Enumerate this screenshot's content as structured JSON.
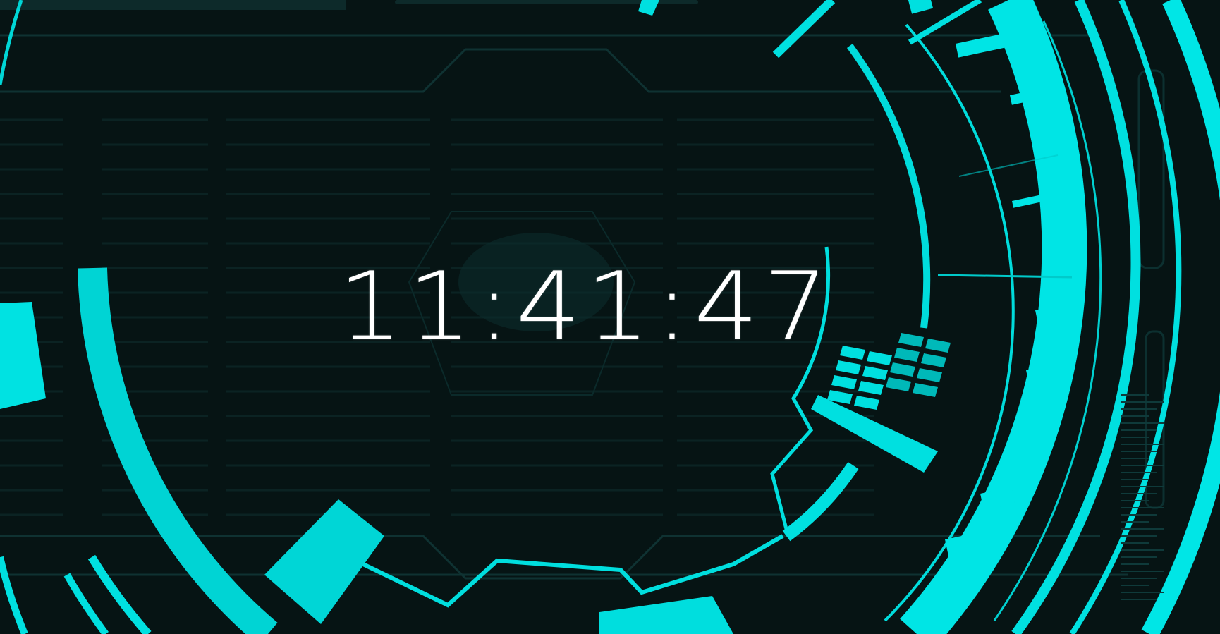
{
  "clock": {
    "time": "11:41:47"
  },
  "colors": {
    "background": "#061414",
    "panel": "#0a2424",
    "grid": "#123434",
    "accent": "#00e5e5",
    "accent_dim": "#00b8b8",
    "text": "#ffffff"
  }
}
